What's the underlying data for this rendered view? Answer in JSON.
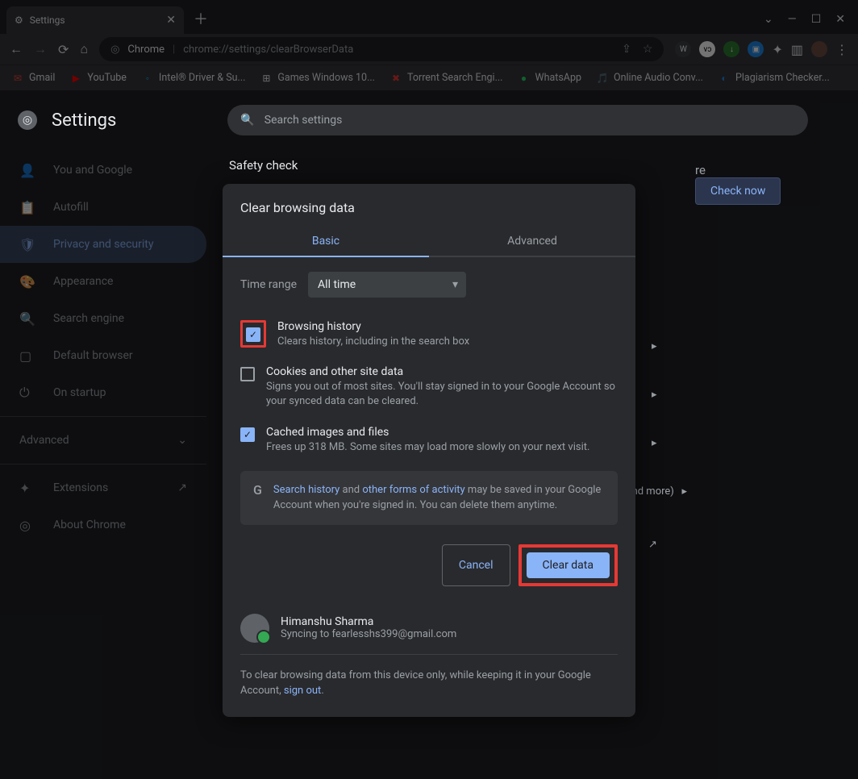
{
  "tab": {
    "title": "Settings"
  },
  "omnibox": {
    "scheme_label": "Chrome",
    "url": "chrome://settings/clearBrowserData"
  },
  "bookmarks": [
    {
      "label": "Gmail"
    },
    {
      "label": "YouTube"
    },
    {
      "label": "Intel® Driver & Su..."
    },
    {
      "label": "Games Windows 10..."
    },
    {
      "label": "Torrent Search Engi..."
    },
    {
      "label": "WhatsApp"
    },
    {
      "label": "Online Audio Conv..."
    },
    {
      "label": "Plagiarism Checker..."
    }
  ],
  "header": {
    "title": "Settings",
    "search_placeholder": "Search settings"
  },
  "sidebar": {
    "items": [
      {
        "label": "You and Google"
      },
      {
        "label": "Autofill"
      },
      {
        "label": "Privacy and security"
      },
      {
        "label": "Appearance"
      },
      {
        "label": "Search engine"
      },
      {
        "label": "Default browser"
      },
      {
        "label": "On startup"
      }
    ],
    "advanced": "Advanced",
    "extensions": "Extensions",
    "about": "About Chrome"
  },
  "main": {
    "safety_heading": "Safety check",
    "check_now": "Check now",
    "bg_text1": "re",
    "bg_text2": "s, and more)"
  },
  "modal": {
    "title": "Clear browsing data",
    "tab_basic": "Basic",
    "tab_advanced": "Advanced",
    "time_range_label": "Time range",
    "time_range_value": "All time",
    "opts": [
      {
        "title": "Browsing history",
        "desc": "Clears history, including in the search box",
        "checked": true,
        "highlight": true
      },
      {
        "title": "Cookies and other site data",
        "desc": "Signs you out of most sites. You'll stay signed in to your Google Account so your synced data can be cleared.",
        "checked": false
      },
      {
        "title": "Cached images and files",
        "desc": "Frees up 318 MB. Some sites may load more slowly on your next visit.",
        "checked": true
      }
    ],
    "info_link1": "Search history",
    "info_mid1": " and ",
    "info_link2": "other forms of activity",
    "info_tail": " may be saved in your Google Account when you're signed in. You can delete them anytime.",
    "cancel": "Cancel",
    "clear": "Clear data",
    "user_name": "Himanshu Sharma",
    "user_sync": "Syncing to fearlesshs399@gmail.com",
    "footer_pre": "To clear browsing data from this device only, while keeping it in your Google Account, ",
    "footer_link": "sign out",
    "footer_post": "."
  }
}
